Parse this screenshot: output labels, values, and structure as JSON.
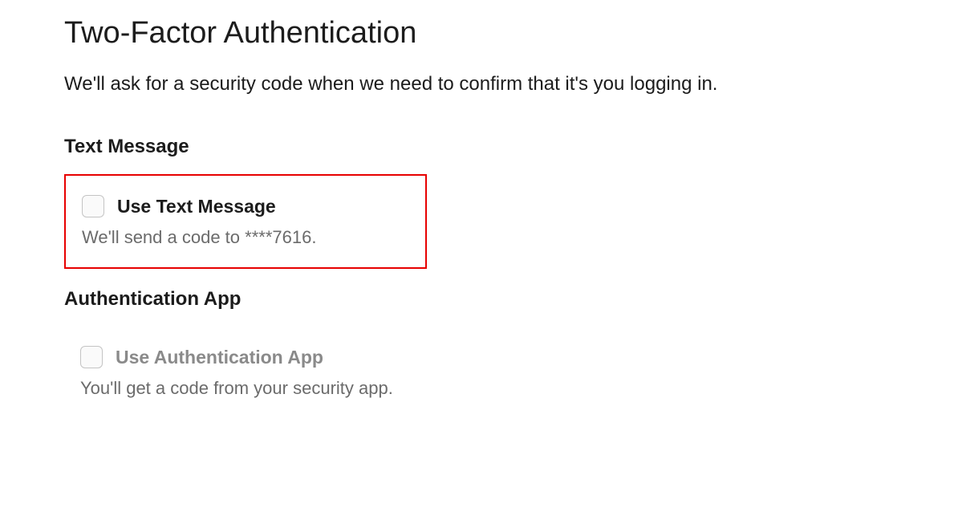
{
  "page": {
    "title": "Two-Factor Authentication",
    "description": "We'll ask for a security code when we need to confirm that it's you logging in."
  },
  "sections": {
    "text_message": {
      "heading": "Text Message",
      "option_label": "Use Text Message",
      "option_description": "We'll send a code to ****7616."
    },
    "auth_app": {
      "heading": "Authentication App",
      "option_label": "Use Authentication App",
      "option_description": "You'll get a code from your security app."
    }
  }
}
